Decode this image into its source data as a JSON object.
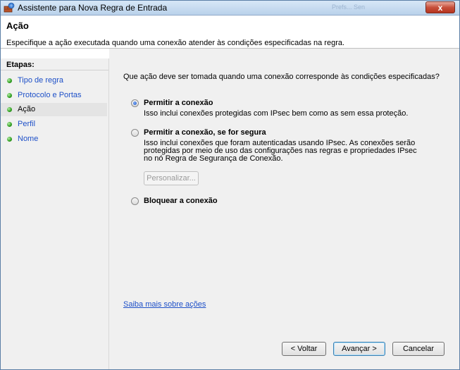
{
  "window": {
    "title": "Assistente para Nova Regra de Entrada",
    "close_symbol": "x",
    "background_title": "Prefs...  Sen"
  },
  "header": {
    "title": "Ação",
    "description": "Especifique a ação executada quando uma conexão atender às condições especificadas na regra."
  },
  "sidebar": {
    "title": "Etapas:",
    "steps": [
      {
        "label": "Tipo de regra"
      },
      {
        "label": "Protocolo e Portas"
      },
      {
        "label": "Ação"
      },
      {
        "label": "Perfil"
      },
      {
        "label": "Nome"
      }
    ],
    "current_step": "Ação"
  },
  "main": {
    "question": "Que ação deve ser tomada quando uma conexão corresponde às condições especificadas?",
    "options": [
      {
        "label": "Permitir a conexão",
        "description": "Isso inclui conexões protegidas com IPsec bem como as sem essa proteção.",
        "selected": true
      },
      {
        "label": "Permitir a conexão, se for segura",
        "description": "Isso inclui conexões que foram autenticadas usando IPsec. As conexões serão protegidas por meio de uso das configurações nas regras e propriedades IPsec no nó Regra de Segurança de Conexão.",
        "selected": false
      },
      {
        "label": "Bloquear a conexão",
        "description": "",
        "selected": false
      }
    ],
    "customize_button": "Personalizar...",
    "learn_more_link": "Saiba mais sobre ações"
  },
  "footer": {
    "back_button": "< Voltar",
    "next_button": "Avançar >",
    "cancel_button": "Cancelar"
  },
  "colors": {
    "link": "#1e50c8",
    "step_dot": "#2e9d1e",
    "close_button": "#c7503b"
  }
}
